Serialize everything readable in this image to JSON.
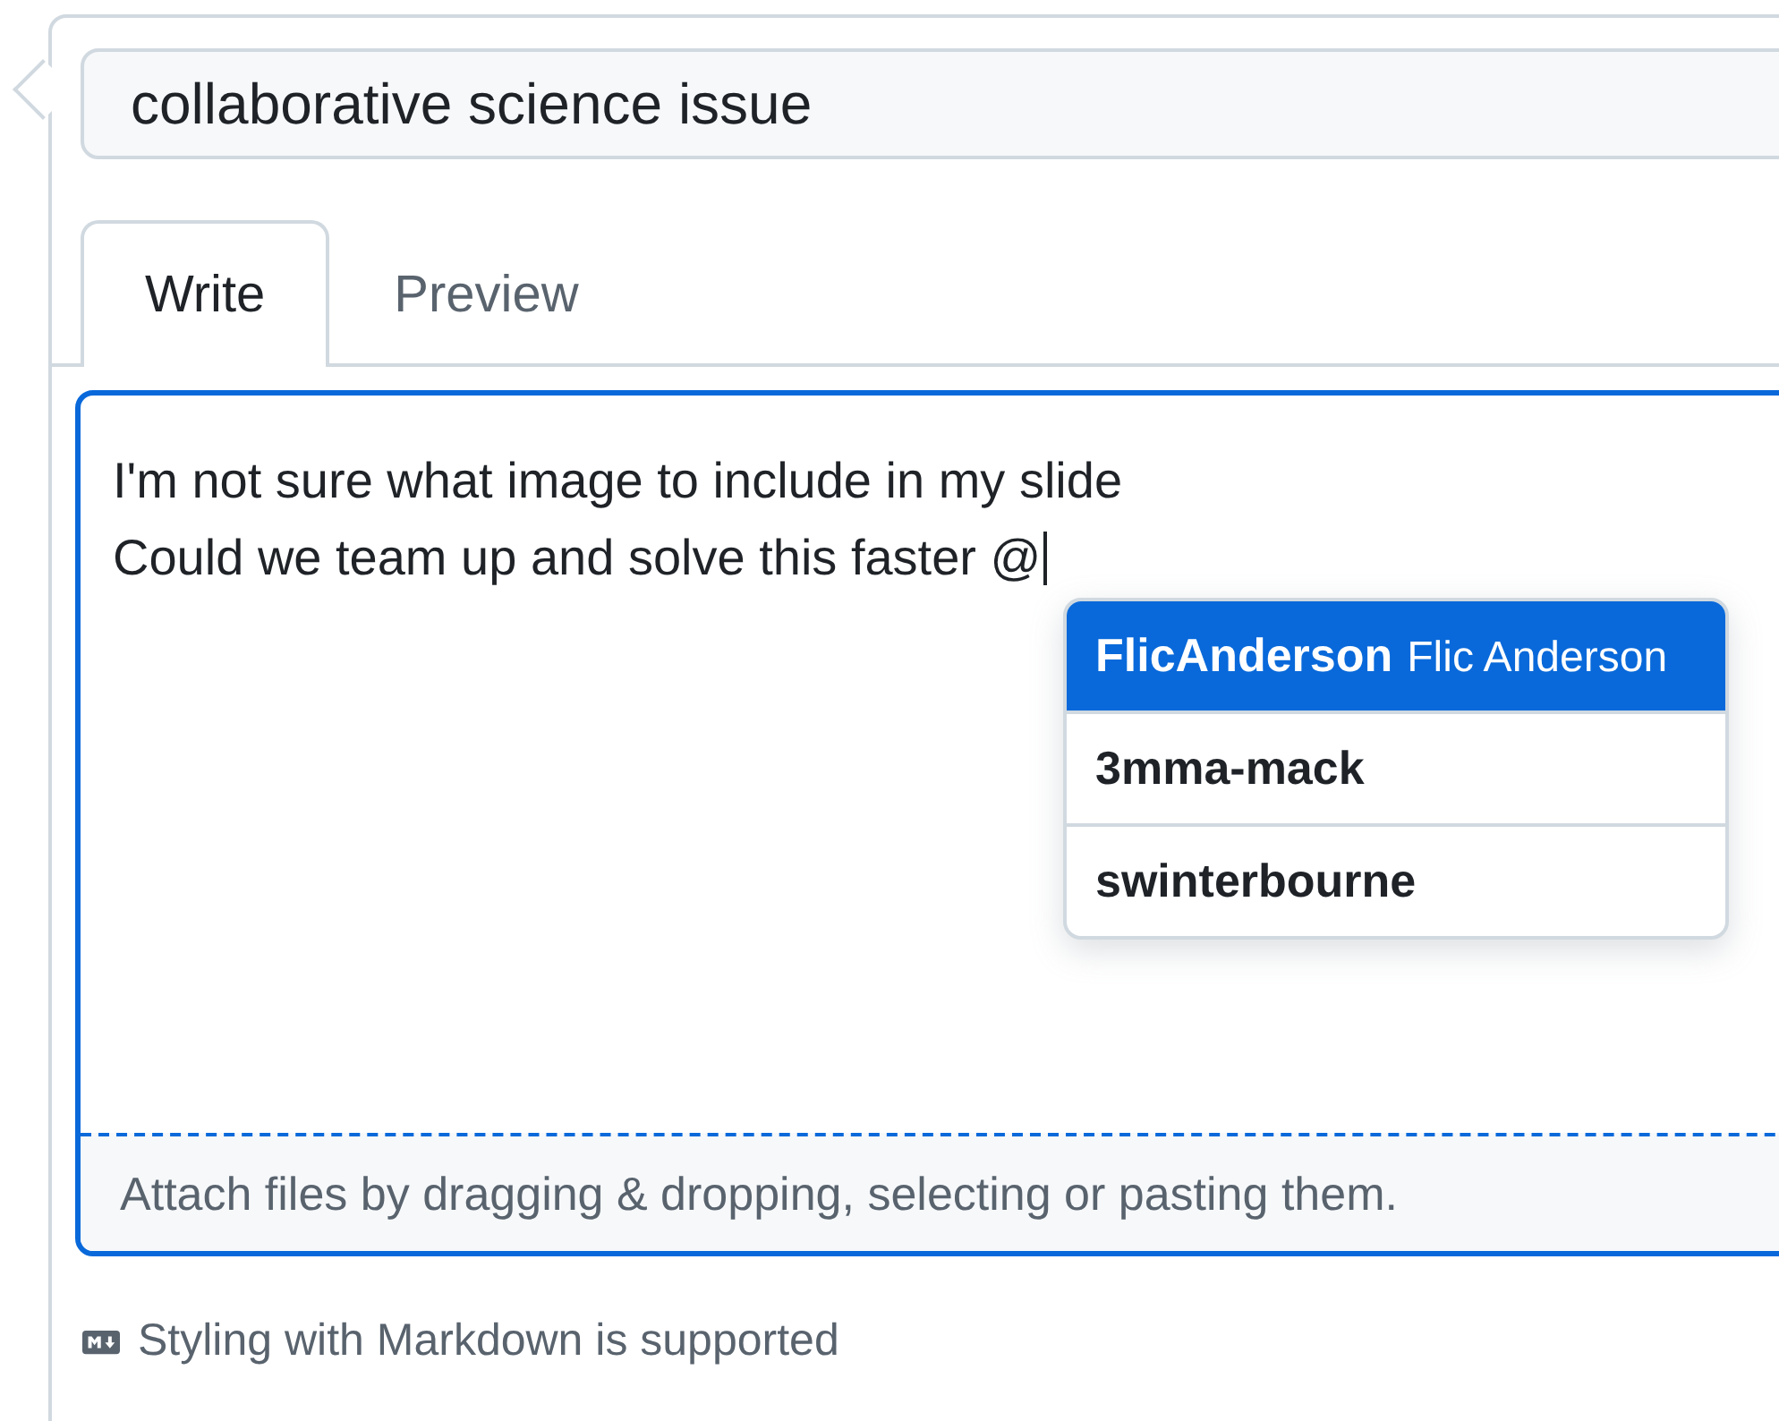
{
  "title_field": {
    "value": "collaborative science issue"
  },
  "tabs": [
    {
      "label": "Write",
      "selected": true
    },
    {
      "label": "Preview",
      "selected": false
    }
  ],
  "comment": {
    "lines": [
      "I'm not sure what image to include in my slide",
      "Could we team up and solve this faster @"
    ]
  },
  "mention_suggestions": [
    {
      "login": "FlicAnderson",
      "name": "Flic Anderson",
      "selected": true
    },
    {
      "login": "3mma-mack",
      "selected": false
    },
    {
      "login": "swinterbourne",
      "selected": false
    }
  ],
  "attach_hint": "Attach files by dragging & dropping, selecting or pasting them.",
  "markdown_note": "Styling with Markdown is supported"
}
